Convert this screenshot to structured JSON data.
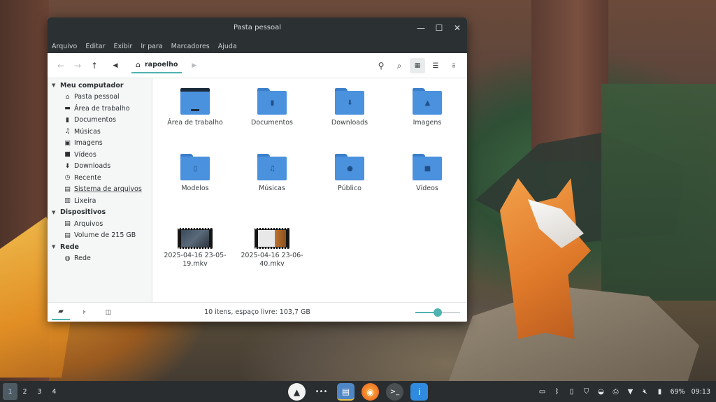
{
  "window": {
    "title": "Pasta pessoal",
    "controls": {
      "minimize": "—",
      "maximize": "☐",
      "close": "✕"
    }
  },
  "menubar": [
    "Arquivo",
    "Editar",
    "Exibir",
    "Ir para",
    "Marcadores",
    "Ajuda"
  ],
  "toolbar": {
    "breadcrumb": "rapoelho"
  },
  "sidebar": {
    "sections": [
      {
        "title": "Meu computador",
        "items": [
          {
            "label": "Pasta pessoal",
            "icon": "home-icon"
          },
          {
            "label": "Área de trabalho",
            "icon": "desktop-icon"
          },
          {
            "label": "Documentos",
            "icon": "document-icon"
          },
          {
            "label": "Músicas",
            "icon": "music-icon"
          },
          {
            "label": "Imagens",
            "icon": "image-icon"
          },
          {
            "label": "Vídeos",
            "icon": "video-icon"
          },
          {
            "label": "Downloads",
            "icon": "download-icon"
          },
          {
            "label": "Recente",
            "icon": "clock-icon"
          },
          {
            "label": "Sistema de arquivos",
            "icon": "drive-icon"
          },
          {
            "label": "Lixeira",
            "icon": "trash-icon"
          }
        ]
      },
      {
        "title": "Dispositivos",
        "items": [
          {
            "label": "Arquivos",
            "icon": "drive-icon"
          },
          {
            "label": "Volume de 215 GB",
            "icon": "drive-icon"
          }
        ]
      },
      {
        "title": "Rede",
        "items": [
          {
            "label": "Rede",
            "icon": "network-icon"
          }
        ]
      }
    ]
  },
  "files": [
    {
      "label": "Área de trabalho",
      "type": "desktop-folder"
    },
    {
      "label": "Documentos",
      "type": "folder",
      "glyph": "▮"
    },
    {
      "label": "Downloads",
      "type": "folder",
      "glyph": "⬇"
    },
    {
      "label": "Imagens",
      "type": "folder",
      "glyph": "▲"
    },
    {
      "label": "Modelos",
      "type": "folder",
      "glyph": "▯"
    },
    {
      "label": "Músicas",
      "type": "folder",
      "glyph": "♫"
    },
    {
      "label": "Público",
      "type": "folder",
      "glyph": "●"
    },
    {
      "label": "Vídeos",
      "type": "folder",
      "glyph": "■"
    },
    {
      "label": "2025-04-16 23-05-19.mkv",
      "type": "video"
    },
    {
      "label": "2025-04-16 23-06-40.mkv",
      "type": "video2"
    }
  ],
  "status": {
    "text": "10 itens, espaço livre: 103,7 GB",
    "zoom_level": 0.5
  },
  "panel": {
    "workspaces": [
      "1",
      "2",
      "3",
      "4"
    ],
    "active_workspace": 0,
    "battery": "69%",
    "clock": "09:13"
  },
  "colors": {
    "accent": "#4fb3b0",
    "folder": "#4a91de",
    "titlebar": "#2b3033"
  }
}
